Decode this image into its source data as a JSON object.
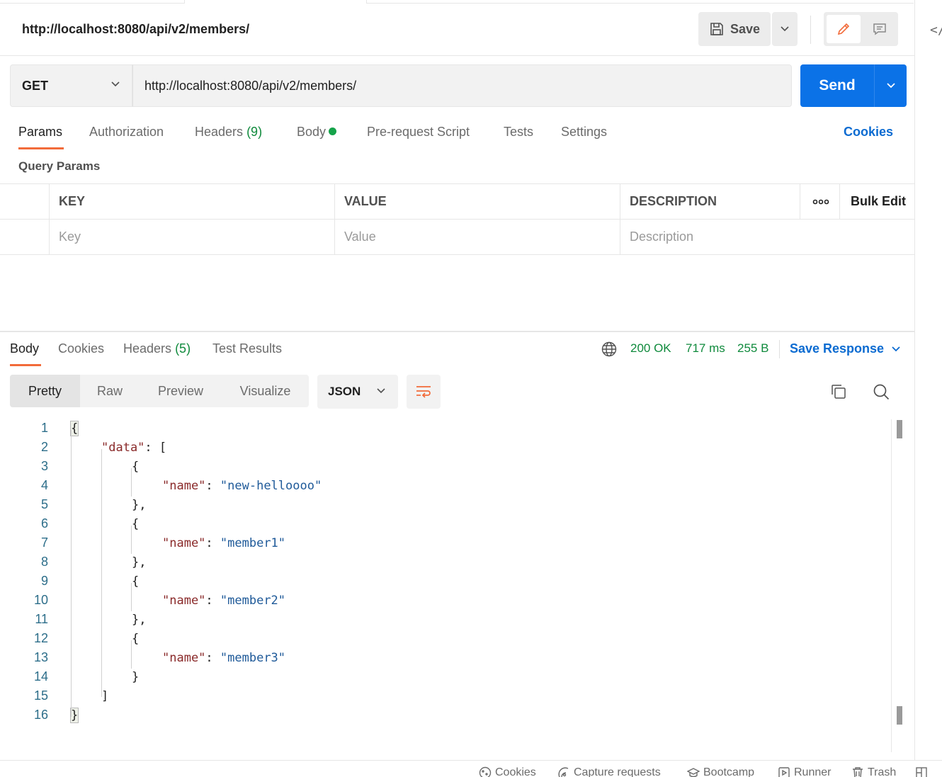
{
  "request": {
    "title": "http://localhost:8080/api/v2/members/",
    "save_label": "Save",
    "method": "GET",
    "url": "http://localhost:8080/api/v2/members/",
    "send_label": "Send"
  },
  "request_tabs": {
    "params": "Params",
    "authorization": "Authorization",
    "headers": "Headers",
    "headers_count": "(9)",
    "body": "Body",
    "pre_request": "Pre-request Script",
    "tests": "Tests",
    "settings": "Settings",
    "cookies": "Cookies"
  },
  "query_params": {
    "title": "Query Params",
    "columns": [
      "KEY",
      "VALUE",
      "DESCRIPTION"
    ],
    "more_icon": "more-horizontal-icon",
    "bulk_edit": "Bulk Edit",
    "placeholders": [
      "Key",
      "Value",
      "Description"
    ]
  },
  "response_tabs": {
    "body": "Body",
    "cookies": "Cookies",
    "headers": "Headers",
    "headers_count": "(5)",
    "test_results": "Test Results"
  },
  "response_status": {
    "status": "200 OK",
    "time": "717 ms",
    "size": "255 B",
    "save_response": "Save Response"
  },
  "view_modes": [
    "Pretty",
    "Raw",
    "Preview",
    "Visualize"
  ],
  "format": "JSON",
  "code_lines": [
    {
      "n": "1",
      "text": "{"
    },
    {
      "n": "2",
      "key": "\"data\"",
      "rest": ": ["
    },
    {
      "n": "3",
      "text": "{"
    },
    {
      "n": "4",
      "key": "\"name\"",
      "sep": ": ",
      "val": "\"new-helloooo\""
    },
    {
      "n": "5",
      "text": "},"
    },
    {
      "n": "6",
      "text": "{"
    },
    {
      "n": "7",
      "key": "\"name\"",
      "sep": ": ",
      "val": "\"member1\""
    },
    {
      "n": "8",
      "text": "},"
    },
    {
      "n": "9",
      "text": "{"
    },
    {
      "n": "10",
      "key": "\"name\"",
      "sep": ": ",
      "val": "\"member2\""
    },
    {
      "n": "11",
      "text": "},"
    },
    {
      "n": "12",
      "text": "{"
    },
    {
      "n": "13",
      "key": "\"name\"",
      "sep": ": ",
      "val": "\"member3\""
    },
    {
      "n": "14",
      "text": "}"
    },
    {
      "n": "15",
      "text": "]"
    },
    {
      "n": "16",
      "text": "}"
    }
  ],
  "footer": {
    "cookies": "Cookies",
    "capture": "Capture requests",
    "bootcamp": "Bootcamp",
    "runner": "Runner",
    "trash": "Trash"
  },
  "colors": {
    "accent_orange": "#f26b3a",
    "send_blue": "#0b72e7",
    "link_blue": "#0b6bd1",
    "status_green": "#0f8a3c"
  }
}
